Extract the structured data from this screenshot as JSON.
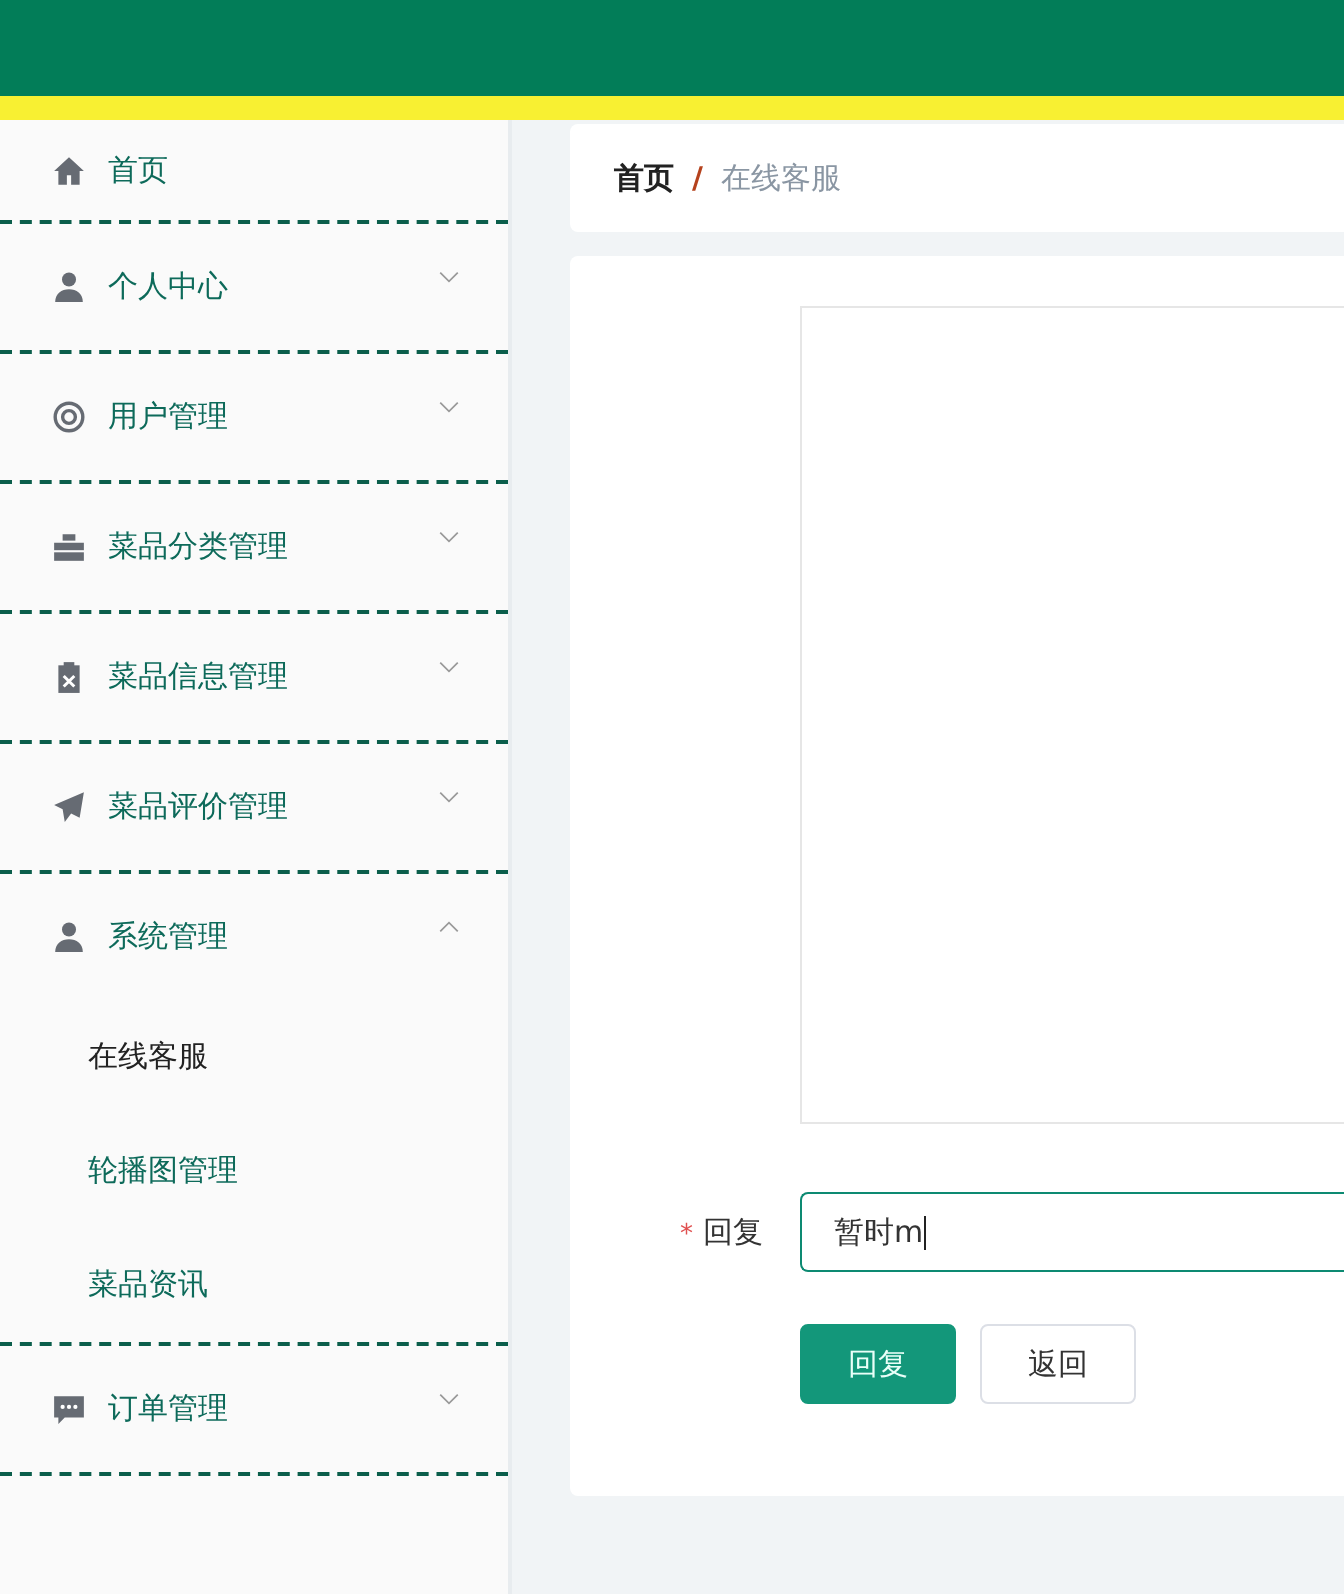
{
  "menu": [
    {
      "label": "首页"
    },
    {
      "label": "个人中心",
      "expanded": false
    },
    {
      "label": "用户管理",
      "expanded": false
    },
    {
      "label": "菜品分类管理",
      "expanded": false
    },
    {
      "label": "菜品信息管理",
      "expanded": false
    },
    {
      "label": "菜品评价管理",
      "expanded": false
    },
    {
      "label": "系统管理",
      "expanded": true,
      "children": [
        {
          "label": "在线客服",
          "selected": true
        },
        {
          "label": "轮播图管理",
          "selected": false
        },
        {
          "label": "菜品资讯",
          "selected": false
        }
      ]
    },
    {
      "label": "订单管理",
      "expanded": false
    }
  ],
  "breadcrumb": [
    "首页",
    "在线客服"
  ],
  "breadcrumb_separator": "/",
  "reply_form": {
    "required_mark": "*",
    "label": "回复",
    "value": "暂时m",
    "focused": true
  },
  "buttons": [
    {
      "label": "回复",
      "kind": "primary"
    },
    {
      "label": "返回",
      "kind": "default"
    }
  ]
}
